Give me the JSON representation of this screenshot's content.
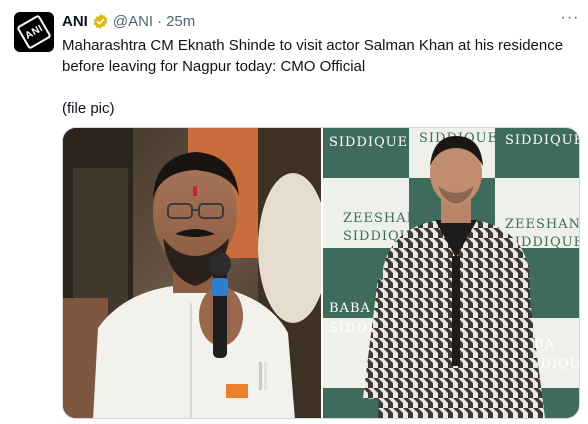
{
  "tweet": {
    "author_name": "ANI",
    "author_handle": "@ANI",
    "separator": "·",
    "time_ago": "25m",
    "more_glyph": "···",
    "text_line1": "Maharashtra CM Eknath Shinde to visit actor Salman Khan at his residence",
    "text_line2": "before leaving for Nagpur today: CMO Official",
    "text_line3": "(file pic)"
  },
  "avatar": {
    "logo_text": "ANI"
  },
  "media": {
    "left_photo": {
      "subject": "man-speaking-into-microphone"
    },
    "right_photo": {
      "backdrop_words": [
        "SIDDIQUE",
        "SIDDIQUE",
        "SIDDIQUE",
        "ZEESHAN",
        "SIDDIQUE",
        "ZEESHAN",
        "SIDDIQUE",
        "BABA",
        "SIDDIQUE",
        "BABA",
        "SIDDIQUE"
      ]
    }
  },
  "colors": {
    "verified_badge": "#e2b719",
    "secondary_text": "#536471",
    "backdrop_green": "#3f6b5c"
  }
}
